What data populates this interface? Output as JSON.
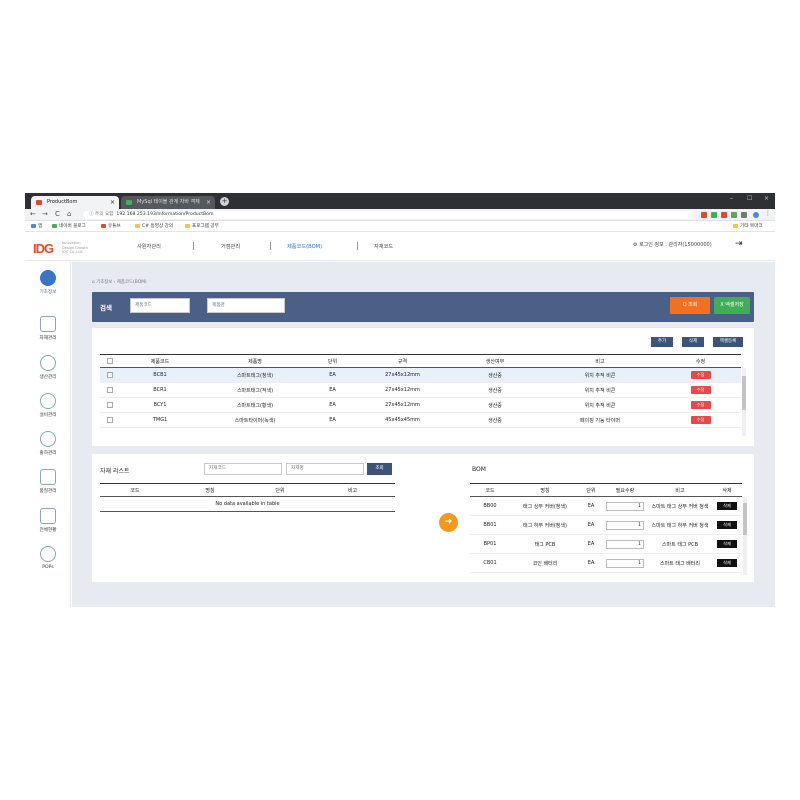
{
  "browser": {
    "tabs": [
      {
        "title": "ProductBom",
        "close": "×",
        "icon_color": "#e04b2a"
      },
      {
        "title": "MySql 테이블 관계 자바 객체",
        "close": "×",
        "icon_color": "#3fae56"
      }
    ],
    "new_tab": "+",
    "window_controls": [
      "–",
      "☐",
      "×"
    ],
    "nav": [
      "←",
      "→",
      "C",
      "⌂"
    ],
    "security": "ⓘ 주의 요함",
    "url": "192.168.253.193/Information/ProductBom",
    "ext_colors": [
      "#e04b2a",
      "#3fae56",
      "#d94c3c",
      "#5aa55a",
      "#777777",
      "#4a87d7"
    ],
    "bookmarks": [
      {
        "label": "앱"
      },
      {
        "label": "네이버 블로그"
      },
      {
        "label": "유튜브"
      },
      {
        "label": "C# 동영상 강의"
      },
      {
        "label": "프로그램 공부"
      }
    ],
    "bookmark_other": "기타 북마크"
  },
  "app": {
    "logo": "IDG",
    "logo_sub": "Innovation Design Growth IDG Co.,Ltd.",
    "menu": [
      "사원자관리",
      "거점관리",
      "제품코드(BOM)",
      "자재코드"
    ],
    "active_menu": 2,
    "user": "로그인 정보 : 관리자(15000000)",
    "exit_icon": "⇥"
  },
  "sidebar": [
    {
      "label": "기초정보",
      "active": true
    },
    {
      "label": "자재관리"
    },
    {
      "label": "생산관리"
    },
    {
      "label": "설비관리"
    },
    {
      "label": "출하관리"
    },
    {
      "label": "품질관리"
    },
    {
      "label": "전체현황"
    },
    {
      "label": "POPs"
    }
  ],
  "breadcrumb": "⌂  기초정보 › 제품코드(BOM)",
  "search": {
    "title": "검색",
    "code_placeholder": "제품코드",
    "name_placeholder": "제품명",
    "query_button": "Q 조회",
    "excel_button": "X 엑셀저장"
  },
  "product_actions": [
    "추가",
    "삭제",
    "엑셀등록"
  ],
  "product_table": {
    "headers": [
      "",
      "제품코드",
      "제품명",
      "단위",
      "규격",
      "생산여부",
      "비고",
      "수정"
    ],
    "rows": [
      {
        "code": "BCB1",
        "name": "스마트태그(청색)",
        "unit": "EA",
        "spec": "27x45x12mm",
        "status": "생산중",
        "note": "위치 추적 비콘",
        "edit": "수정"
      },
      {
        "code": "BCR1",
        "name": "스마트태그(적색)",
        "unit": "EA",
        "spec": "27x45x12mm",
        "status": "생산중",
        "note": "위치 추적 비콘",
        "edit": "수정"
      },
      {
        "code": "BCY1",
        "name": "스마트태그(황색)",
        "unit": "EA",
        "spec": "27x45x12mm",
        "status": "생산중",
        "note": "위치 추적 비콘",
        "edit": "수정"
      },
      {
        "code": "TMG1",
        "name": "스마트타이머(녹색)",
        "unit": "EA",
        "spec": "45x45x45mm",
        "status": "생산중",
        "note": "페이징 기능 타이머",
        "edit": "수정"
      }
    ]
  },
  "material_list": {
    "title": "자재 리스트",
    "code_placeholder": "자재코드",
    "name_placeholder": "자재명",
    "query_button": "조회",
    "headers": [
      "코드",
      "명칭",
      "단위",
      "비고"
    ],
    "empty": "No data available in table"
  },
  "bom": {
    "title": "BOM",
    "headers": [
      "코드",
      "명칭",
      "단위",
      "필요수량",
      "비고",
      "삭제"
    ],
    "rows": [
      {
        "code": "BB00",
        "name": "태그 상부 커버(청색)",
        "unit": "EA",
        "qty": "1",
        "note": "스마트 태그 상부 커버 청색",
        "del": "삭제"
      },
      {
        "code": "BB01",
        "name": "태그 하부 커버(청색)",
        "unit": "EA",
        "qty": "1",
        "note": "스마트 태그 하부 커버 청색",
        "del": "삭제"
      },
      {
        "code": "BP01",
        "name": "태그 PCB",
        "unit": "EA",
        "qty": "1",
        "note": "스마트 태그 PCB",
        "del": "삭제"
      },
      {
        "code": "CB01",
        "name": "코인 배터리",
        "unit": "EA",
        "qty": "1",
        "note": "스마트 태그 배터리",
        "del": "삭제"
      }
    ]
  }
}
